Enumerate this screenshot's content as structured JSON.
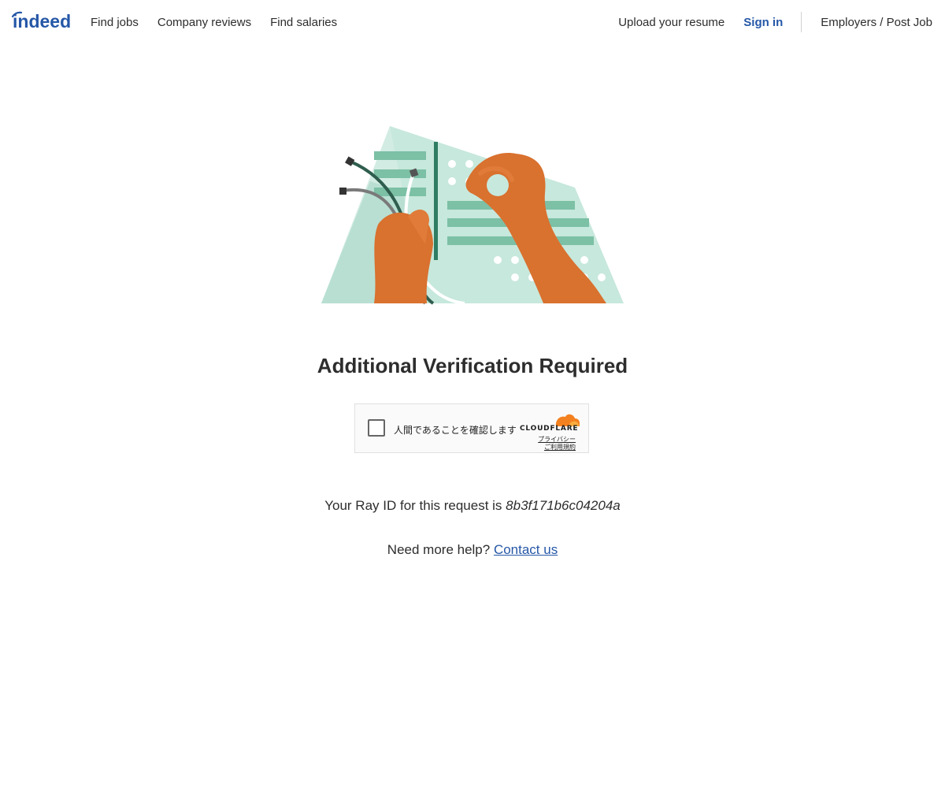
{
  "header": {
    "logo_text": "indeed",
    "nav_left": [
      "Find jobs",
      "Company reviews",
      "Find salaries"
    ],
    "upload_resume": "Upload your resume",
    "sign_in": "Sign in",
    "employers": "Employers / Post Job"
  },
  "main": {
    "title": "Additional Verification Required",
    "challenge": {
      "checkbox_label": "人間であることを確認します",
      "brand": "CLOUDFLARE",
      "privacy_link": "プライバシー",
      "terms_link": "ご利用規約"
    },
    "ray_prefix": "Your Ray ID for this request is ",
    "ray_id": "8b3f171b6c04204a",
    "help_prefix": "Need more help? ",
    "contact_link": "Contact us"
  },
  "colors": {
    "brand_blue": "#2557a7",
    "text": "#2d2d2d",
    "illustration_mint": "#b9dfd3",
    "illustration_green": "#7cc0a6",
    "illustration_dark_green": "#2f7d62",
    "hand_orange": "#e07b39",
    "cloudflare_orange": "#f48120"
  }
}
